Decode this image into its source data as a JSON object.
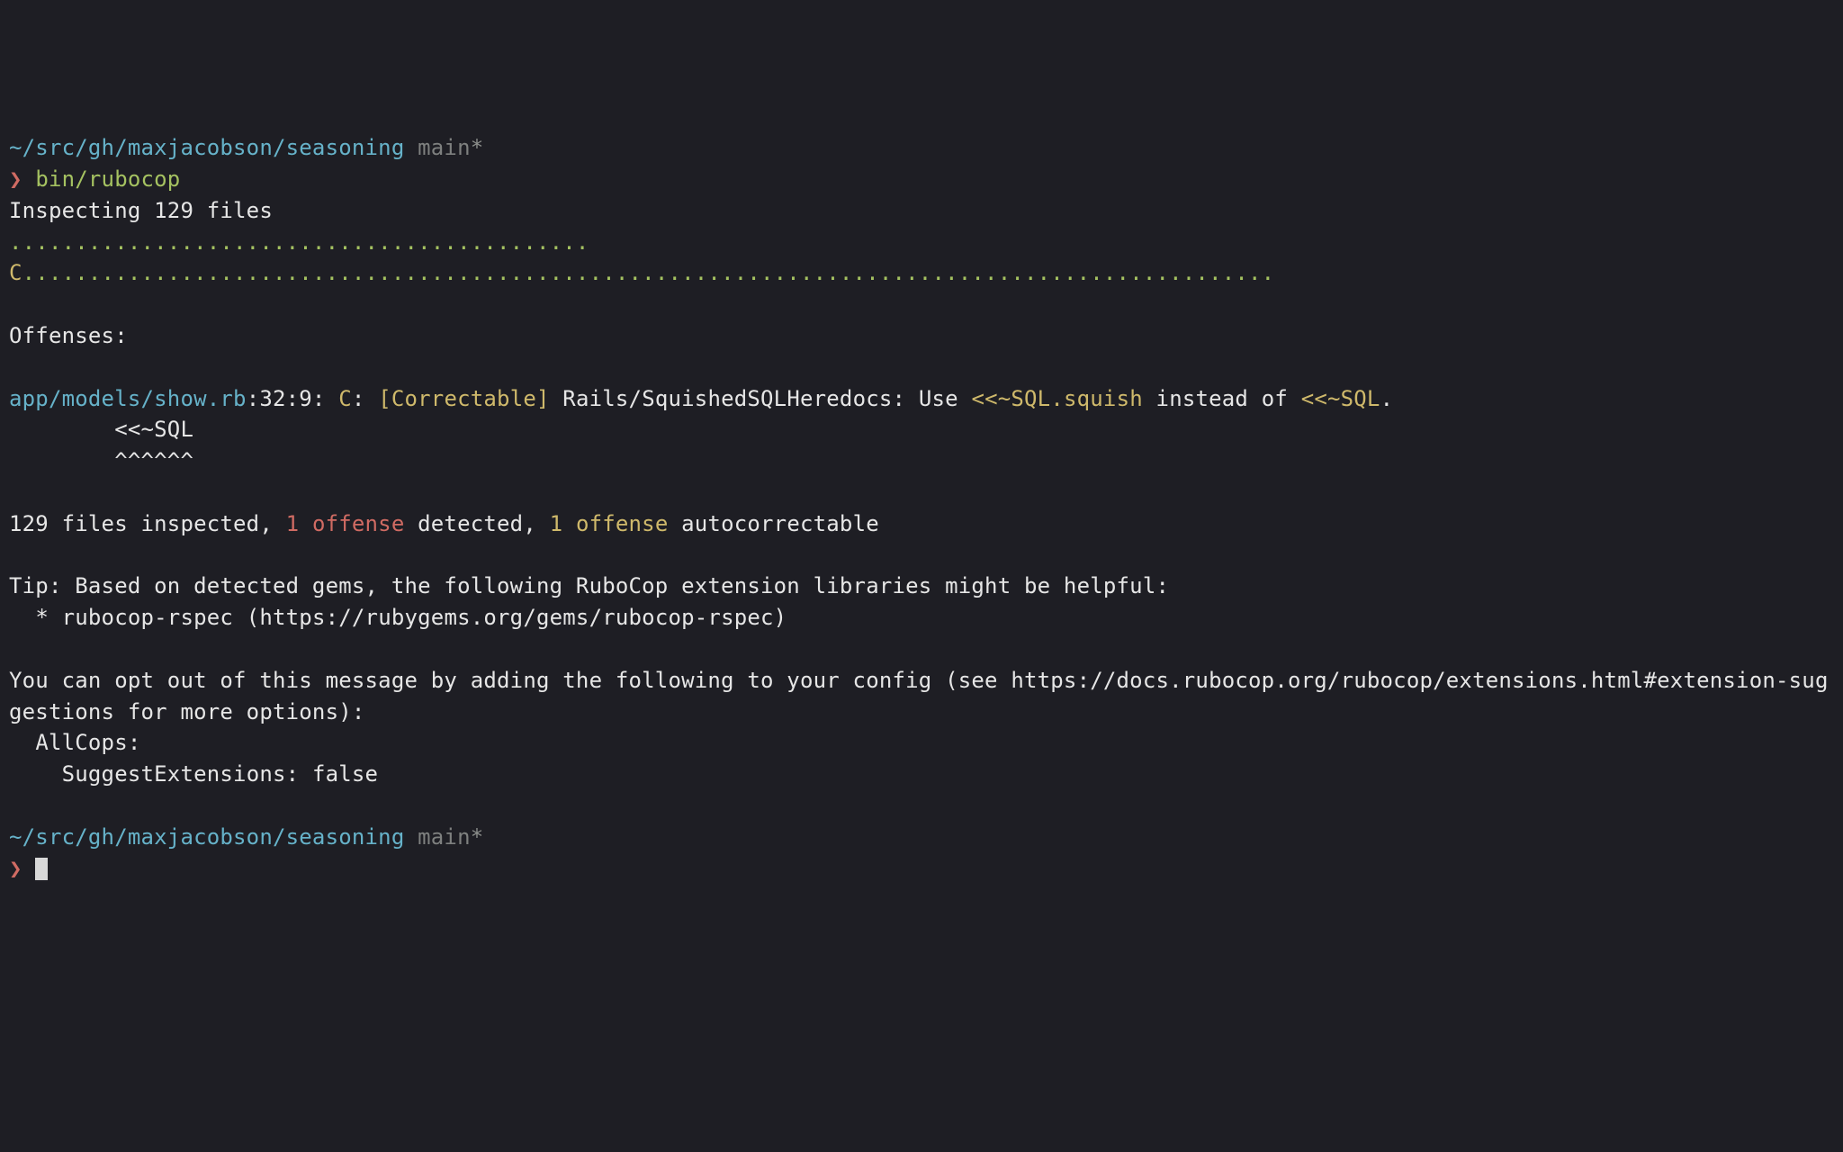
{
  "prompt1": {
    "path": "~/src/gh/maxjacobson/seasoning",
    "branch": " main",
    "star": "*",
    "caret": "❯ ",
    "command": "bin/rubocop"
  },
  "inspect": {
    "text": "Inspecting 129 files"
  },
  "progress": {
    "dots_before_C": "............................................",
    "C": "C",
    "dots_after_C": "..............................................................................................."
  },
  "offenses_header": "Offenses:",
  "off": {
    "file": "app/models/show.rb",
    "loc": ":32:9: ",
    "sev": "C",
    "sep": ": ",
    "correctable": "[Correctable] ",
    "cop": "Rails/SquishedSQLHeredocs: ",
    "msg_pre": "Use ",
    "msg_good": "<<~SQL.squish",
    "msg_mid": " instead of ",
    "msg_bad": "<<~SQL",
    "msg_post": ".",
    "code_line": "        <<~SQL",
    "caret_line": "        ^^^^^^"
  },
  "summary": {
    "t1": "129 files inspected, ",
    "t2": "1 offense",
    "t3": " detected, ",
    "t4": "1 offense",
    "t5": " autocorrectable"
  },
  "tip": {
    "l1": "Tip: Based on detected gems, the following RuboCop extension libraries might be helpful:",
    "l2": "  * rubocop-rspec (https://rubygems.org/gems/rubocop-rspec)"
  },
  "optout": {
    "l1": "You can opt out of this message by adding the following to your config (see https://docs.rubocop.org/rubocop/extensions.html#extension-suggestions for more options):",
    "l2": "  AllCops:",
    "l3": "    SuggestExtensions: false"
  },
  "prompt2": {
    "path": "~/src/gh/maxjacobson/seasoning",
    "branch": " main",
    "star": "*",
    "caret": "❯ "
  }
}
